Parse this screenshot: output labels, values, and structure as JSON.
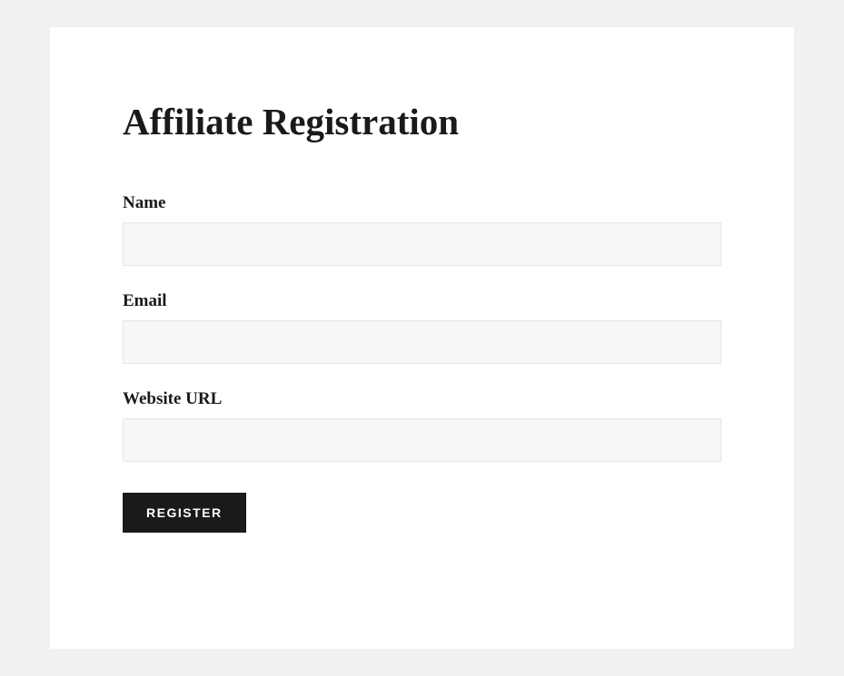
{
  "form": {
    "title": "Affiliate Registration",
    "fields": {
      "name": {
        "label": "Name",
        "value": ""
      },
      "email": {
        "label": "Email",
        "value": ""
      },
      "website_url": {
        "label": "Website URL",
        "value": ""
      }
    },
    "submit_label": "Register"
  }
}
